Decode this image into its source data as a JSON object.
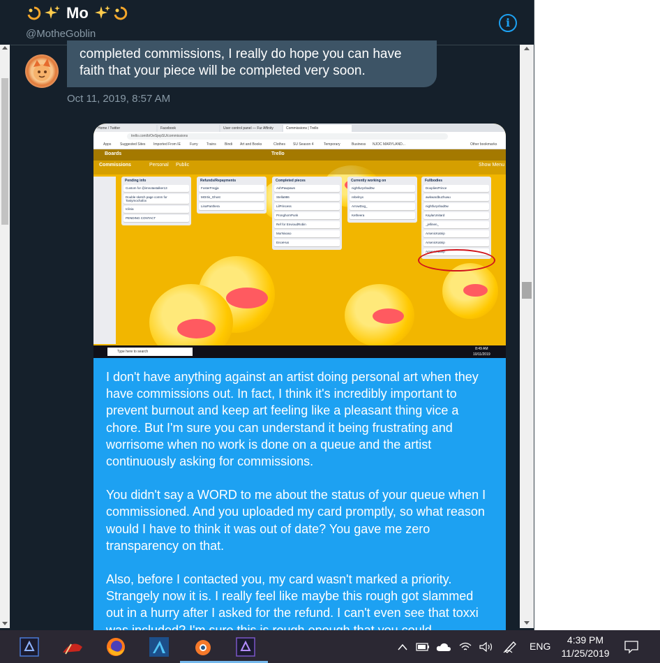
{
  "header": {
    "name": "Mo",
    "handle": "@MotheGoblin",
    "info_icon": "i"
  },
  "messages": {
    "received_text": "completed commissions, I really do hope you can have faith that your piece will be completed very soon.",
    "received_time": "Oct 11, 2019, 8:57 AM",
    "sent_paragraphs": [
      "I don't have anything against an artist doing personal art when they have commissions out. In fact, I think it's incredibly important to prevent burnout and keep art feeling like a pleasant thing vice a chore. But I'm sure you can understand it being frustrating and worrisome when no work is done on a queue and the artist continuously asking for commissions.",
      "You didn't say a WORD to me about the status of your queue when I commissioned. And you uploaded my card promptly, so what reason would I have to think it was out of date? You gave me zero transparency on that.",
      "Also, before I contacted you, my card wasn't marked a priority. Strangely now it is. I really feel like maybe this rough got slammed out in a hurry after I asked for the refund. I can't even see that toxxi was included? I'm sure this is rough enough that you could"
    ]
  },
  "screenshot": {
    "tabs": [
      "Home / Twitter",
      "Facebook",
      "User control panel — Fur Affinity",
      "Commissions | Trello"
    ],
    "url": "trello.com/b/OeSjepSU/commissions",
    "bookmarks": [
      "Apps",
      "Suggested Sites",
      "Imported From IE",
      "Furry",
      "Trains",
      "Bindi",
      "Art and Books",
      "Clothes",
      "SU Season 4",
      "Temporary",
      "Business",
      "NJOC MARYLAND...",
      "Other bookmarks"
    ],
    "trello_logo": "Trello",
    "boards_label": "Boards",
    "board_title": "Commissions",
    "board_visibility": [
      "Personal",
      "Public"
    ],
    "show_menu": "Show Menu",
    "lists": [
      {
        "title": "Pending info",
        "cards": [
          "Custom for @imnotastalker13",
          "Double sketch page comm for Tastymochafox",
          "Iclinia",
          "PENDING CONTACT"
        ]
      },
      {
        "title": "Refunds/Repayments",
        "cards": [
          "FosterFregja",
          "MOrtis_Ghost",
          "LinaPanthera"
        ]
      },
      {
        "title": "Completed pieces",
        "cards": [
          "AshPawpaws",
          "Stella986",
          "LilPrincess",
          "PronghornPunk",
          "Ref for EnvioudRobin",
          "MorNivaso",
          "EnceHus"
        ]
      },
      {
        "title": "Currently working on",
        "cards": [
          "nightfuryshad0w",
          "rebelnyx",
          "ArrowDog_",
          "Ketheera"
        ]
      },
      {
        "title": "Fullbodies",
        "cards": [
          "DoopliesPrince",
          "awkwardbuzhuwu",
          "nightfuryshad0w",
          "KaylarUnitard",
          "_jellinen_",
          "ArsenicKatnip",
          "ArsenicKatnip",
          "ArsenicKatnip"
        ]
      }
    ],
    "taskbar_search": "Type here to search",
    "taskbar_time": "8:49 AM",
    "taskbar_date": "10/11/2019"
  },
  "taskbar": {
    "language": "ENG",
    "time": "4:39 PM",
    "date": "11/25/2019",
    "apps": [
      "affinity-photo-icon",
      "paint-brush-app-icon",
      "firefox-icon",
      "affinity-designer-icon",
      "blender-icon",
      "affinity-photo-icon-2"
    ]
  },
  "colors": {
    "background": "#15202b",
    "sent_bubble": "#1da1f2",
    "received_bubble": "#3d5466",
    "secondary_text": "#8899a6",
    "taskbar": "#2b2833"
  }
}
